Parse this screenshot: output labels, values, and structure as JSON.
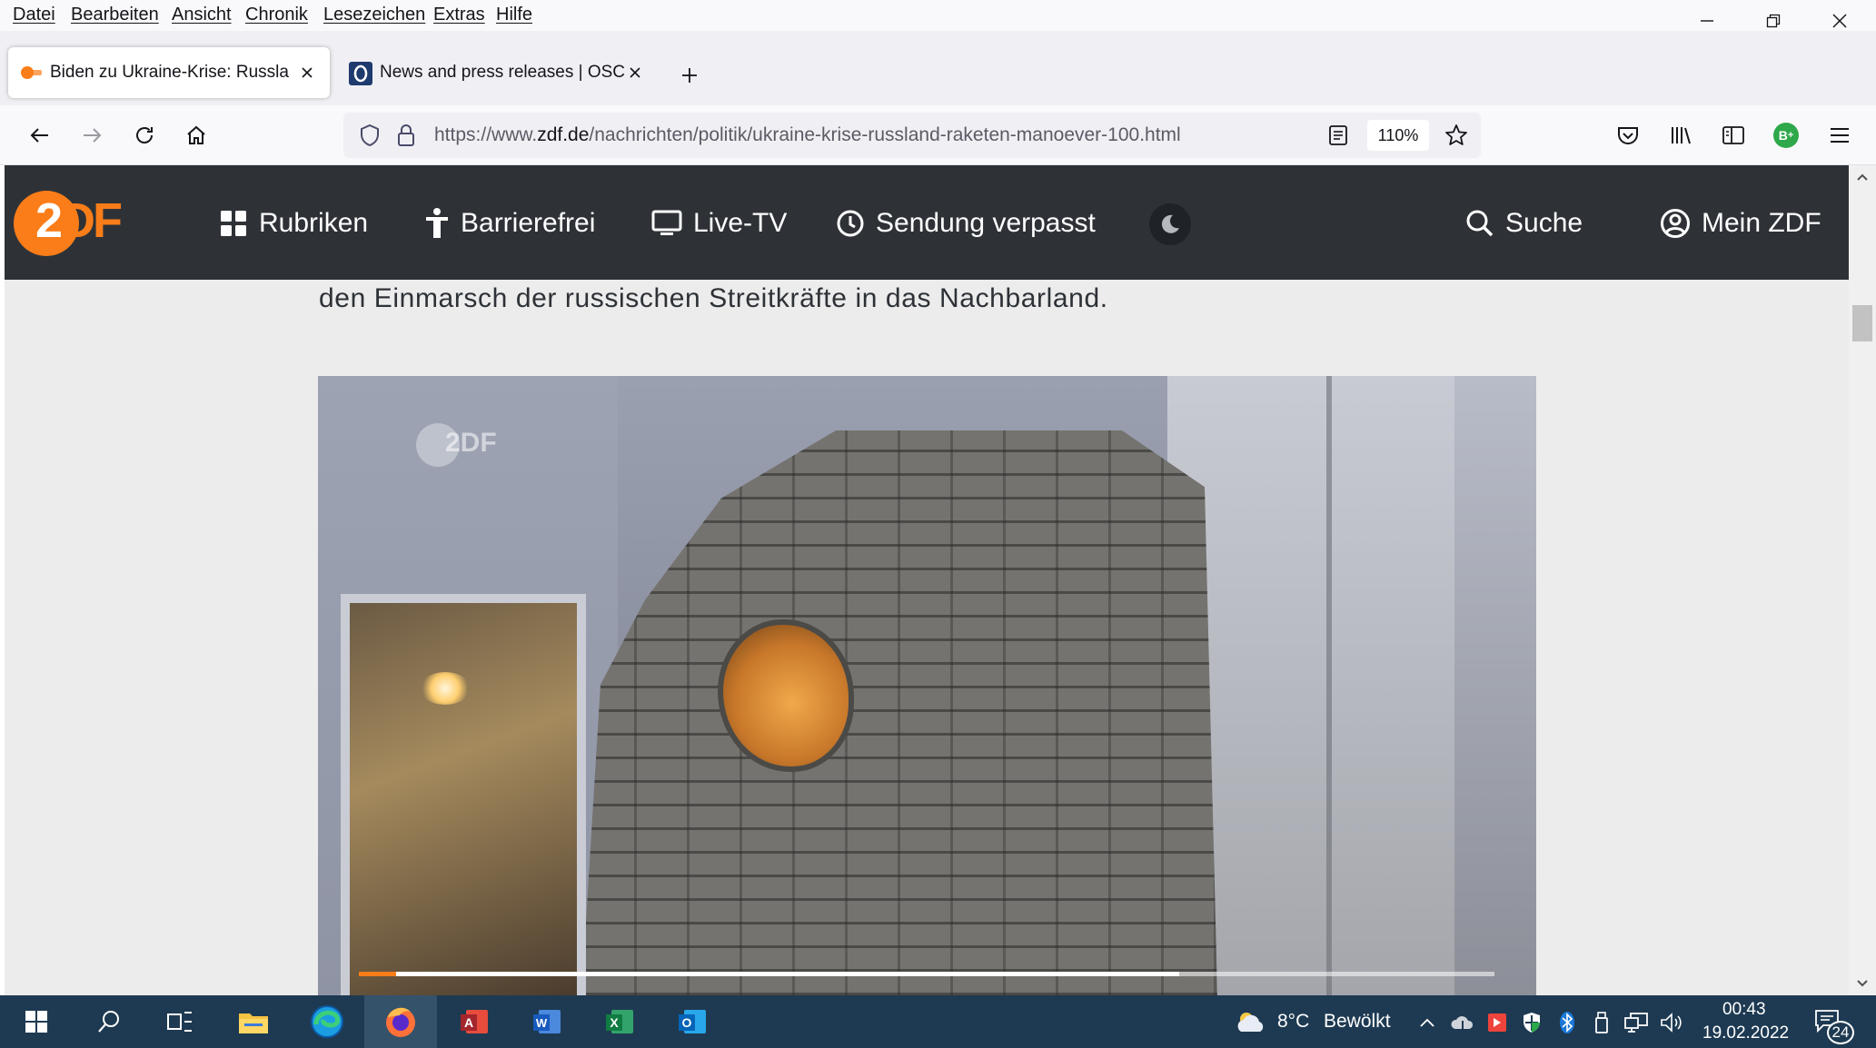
{
  "menubar": {
    "items": [
      "Datei",
      "Bearbeiten",
      "Ansicht",
      "Chronik",
      "Lesezeichen",
      "Extras",
      "Hilfe"
    ]
  },
  "window_controls": {
    "minimize_icon": "minimize-icon",
    "restore_icon": "restore-icon",
    "close_icon": "close-icon"
  },
  "tabs": [
    {
      "title": "Biden zu Ukraine-Krise: Russland",
      "favicon": "zdf-favicon",
      "active": true
    },
    {
      "title": "News and press releases | OSCE",
      "favicon": "osce-favicon",
      "active": false
    }
  ],
  "navbar": {
    "url_prefix": "https://www.",
    "url_host": "zdf.de",
    "url_path": "/nachrichten/politik/ukraine-krise-russland-raketen-manoever-100.html",
    "zoom": "110%",
    "profile_badge": "B"
  },
  "page": {
    "header": {
      "logo_text": "2DF",
      "nav": [
        {
          "label": "Rubriken",
          "icon": "grid-icon"
        },
        {
          "label": "Barrierefrei",
          "icon": "accessibility-icon"
        },
        {
          "label": "Live-TV",
          "icon": "monitor-icon"
        },
        {
          "label": "Sendung verpasst",
          "icon": "clock-icon"
        }
      ],
      "search_label": "Suche",
      "account_label": "Mein ZDF"
    },
    "article_text": "den Einmarsch der russischen Streitkräfte in das Nachbarland.",
    "video": {
      "watermark": "2DF",
      "progress": 0.033,
      "buffered": 0.722
    }
  },
  "taskbar": {
    "weather_temp": "8°C",
    "weather_desc": "Bewölkt",
    "time": "00:43",
    "date": "19.02.2022",
    "notification_count": "24"
  },
  "colors": {
    "zdf_orange": "#fa7d19",
    "zdf_header": "#2e3237",
    "taskbar": "#1e3a52"
  }
}
